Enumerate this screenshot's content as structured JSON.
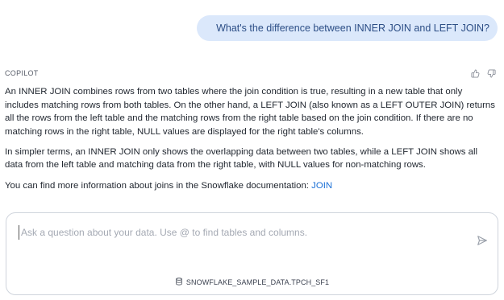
{
  "user_message": {
    "text": "What's the difference between INNER JOIN and LEFT JOIN?"
  },
  "response": {
    "author": "COPILOT",
    "paragraphs": [
      "An INNER JOIN combines rows from two tables where the join condition is true, resulting in a new table that only includes matching rows from both tables. On the other hand, a LEFT JOIN (also known as a LEFT OUTER JOIN) returns all the rows from the left table and the matching rows from the right table based on the join condition. If there are no matching rows in the right table, NULL values are displayed for the right table's columns.",
      "In simpler terms, an INNER JOIN only shows the overlapping data between two tables, while a LEFT JOIN shows all data from the left table and matching data from the right table, with NULL values for non-matching rows."
    ],
    "doc_text": "You can find more information about joins in the Snowflake documentation: ",
    "doc_link": "JOIN",
    "feedback_icons": [
      "thumbs-up-icon",
      "thumbs-down-icon"
    ]
  },
  "composer": {
    "placeholder": "Ask a question about your data. Use @ to find tables and columns.",
    "value": "",
    "send_icon": "send-icon",
    "context_icon": "database-icon",
    "context_label": "SNOWFLAKE_SAMPLE_DATA.TPCH_SF1"
  },
  "colors": {
    "user_bubble_bg": "#dbe8fb",
    "user_bubble_text": "#2c4e86",
    "link": "#1a6fd6"
  }
}
